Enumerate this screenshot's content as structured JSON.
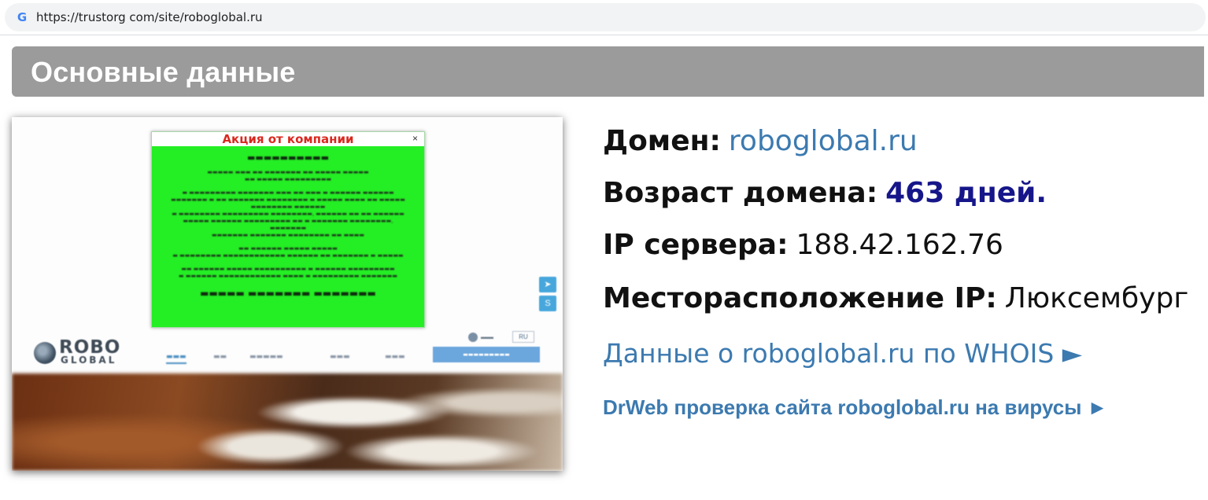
{
  "browser": {
    "favicon": "G",
    "url": "https://trustorg com/site/roboglobal.ru"
  },
  "section": {
    "title": "Основные данные"
  },
  "preview": {
    "popup_title": "Акция от компании",
    "popup_close": "×",
    "nav_lang": "RU",
    "social_icons": [
      "telegram-icon",
      "skype-icon"
    ]
  },
  "info": {
    "domain_label": "Домен:",
    "domain_value": "roboglobal.ru",
    "age_label": "Возраст домена:",
    "age_value": "463 дней.",
    "ip_label": "IP сервера:",
    "ip_value": "188.42.162.76",
    "location_label": "Месторасположение IP:",
    "location_value": "Люксембург",
    "whois_link": "Данные о roboglobal.ru по WHOIS ►",
    "drweb_link": "DrWeb проверка сайта roboglobal.ru на вирусы ►"
  },
  "colors": {
    "link": "#3c7ab0",
    "age": "#16168a",
    "header_bg": "#9b9b9b",
    "popup_bg": "#24ee24"
  }
}
